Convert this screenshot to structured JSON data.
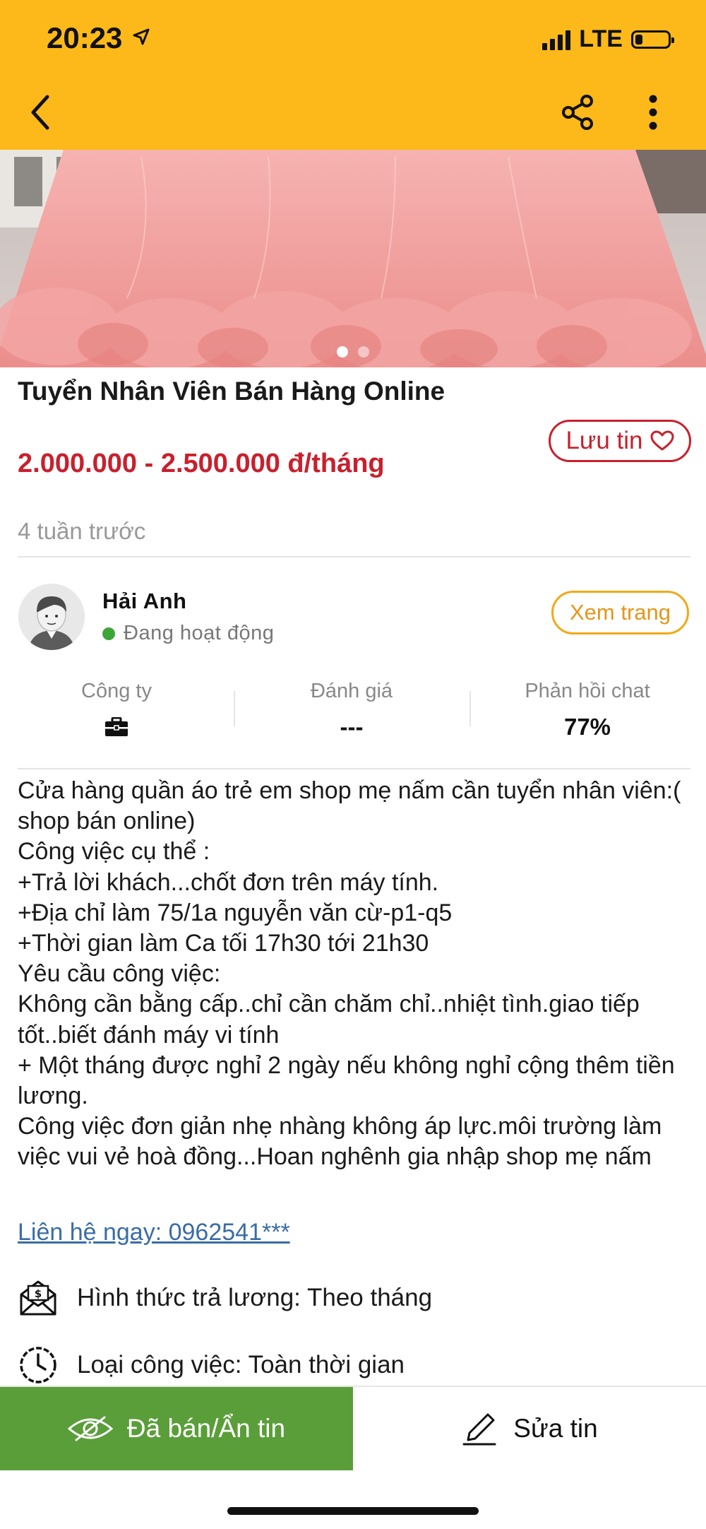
{
  "status_bar": {
    "time": "20:23",
    "network": "LTE"
  },
  "toolbar": {
    "back_icon": "chevron-left-icon",
    "share_icon": "share-icon",
    "more_icon": "more-vertical-icon"
  },
  "listing": {
    "title": "Tuyển Nhân Viên Bán Hàng Online",
    "price": "2.000.000 - 2.500.000 đ/tháng",
    "save_label": "Lưu tin",
    "posted": "4 tuần trước",
    "gallery": {
      "total": 2,
      "active_index": 0
    }
  },
  "seller": {
    "name": "Hải Anh",
    "status": "Đang hoạt động",
    "view_page_label": "Xem trang",
    "stats": [
      {
        "label": "Công ty",
        "value": "",
        "icon": "briefcase-icon"
      },
      {
        "label": "Đánh giá",
        "value": "---"
      },
      {
        "label": "Phản hồi chat",
        "value": "77%"
      }
    ]
  },
  "description": "Cửa hàng quần áo trẻ em shop mẹ nấm cần tuyển nhân viên:( shop bán online)\nCông việc cụ thể :\n+Trả lời khách...chốt đơn trên máy tính.\n+Địa chỉ làm 75/1a nguyễn văn cừ-p1-q5\n+Thời gian làm Ca tối 17h30 tới 21h30\nYêu cầu công việc:\nKhông cần bằng cấp..chỉ cần chăm chỉ..nhiệt tình.giao tiếp tốt..biết đánh máy vi tính\n+ Một tháng được nghỉ 2 ngày nếu không nghỉ cộng thêm tiền lương.\nCông việc đơn giản nhẹ nhàng không áp lực.môi trường làm việc vui vẻ hoà đồng...Hoan nghênh gia nhập shop mẹ nấm",
  "contact_link": "Liên hệ ngay: 0962541***",
  "details": [
    {
      "icon": "salary-envelope-icon",
      "text": "Hình thức trả lương: Theo tháng"
    },
    {
      "icon": "clock-icon",
      "text": "Loại công việc: Toàn thời gian"
    }
  ],
  "actions": {
    "hide_label": "Đã bán/Ẩn tin",
    "edit_label": "Sửa tin"
  },
  "colors": {
    "header": "#fcb919",
    "price": "#c8202d",
    "hide_button": "#5a9e3a",
    "link": "#3a6da5",
    "view_page": "#e5961a",
    "online": "#3ea538"
  }
}
